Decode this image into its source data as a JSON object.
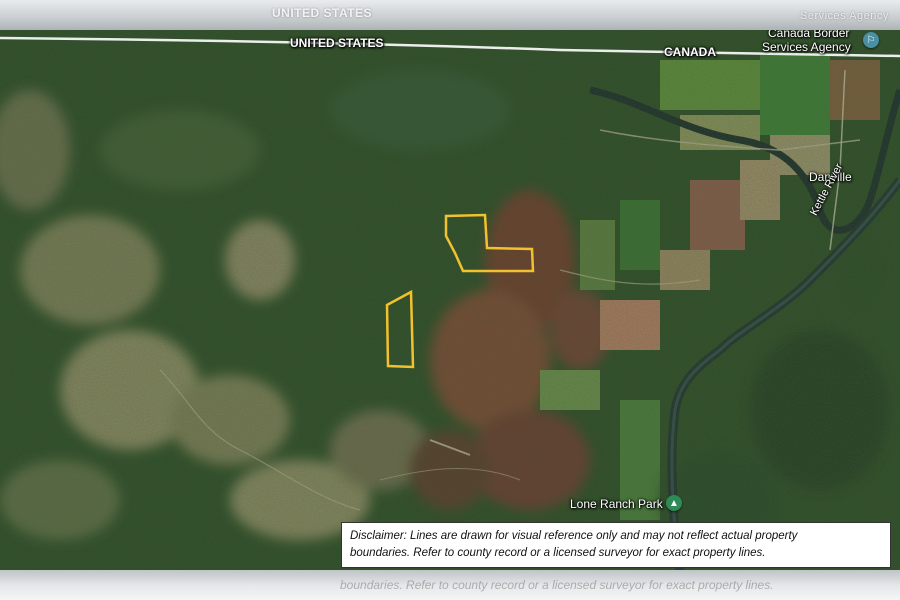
{
  "top_ghost_label": "UNITED STATES",
  "top_ghost_label_right": "Services Agency",
  "border": {
    "us_label": "UNITED STATES",
    "canada_label": "CANADA"
  },
  "places": {
    "border_agency_line1": "Canada Border",
    "border_agency_line2": "Services Agency",
    "danville": "Danville",
    "kettle_river": "Kettle River",
    "lone_ranch_park": "Lone Ranch Park"
  },
  "icons": {
    "border_agency_pin": "government-building-icon",
    "park_pin": "tree-park-icon"
  },
  "colors": {
    "parcel_outline": "#f2c12e",
    "border_line": "#ffffff",
    "border_pin": "#4a90a4",
    "park_pin": "#2e8b57"
  },
  "disclaimer": {
    "line1": "Disclaimer: Lines are drawn for visual reference only and may not reflect actual property",
    "line2": "boundaries. Refer to county record or a licensed surveyor for exact property lines."
  },
  "bottom_ghost_text": "boundaries. Refer to county record or a licensed surveyor for exact property lines."
}
